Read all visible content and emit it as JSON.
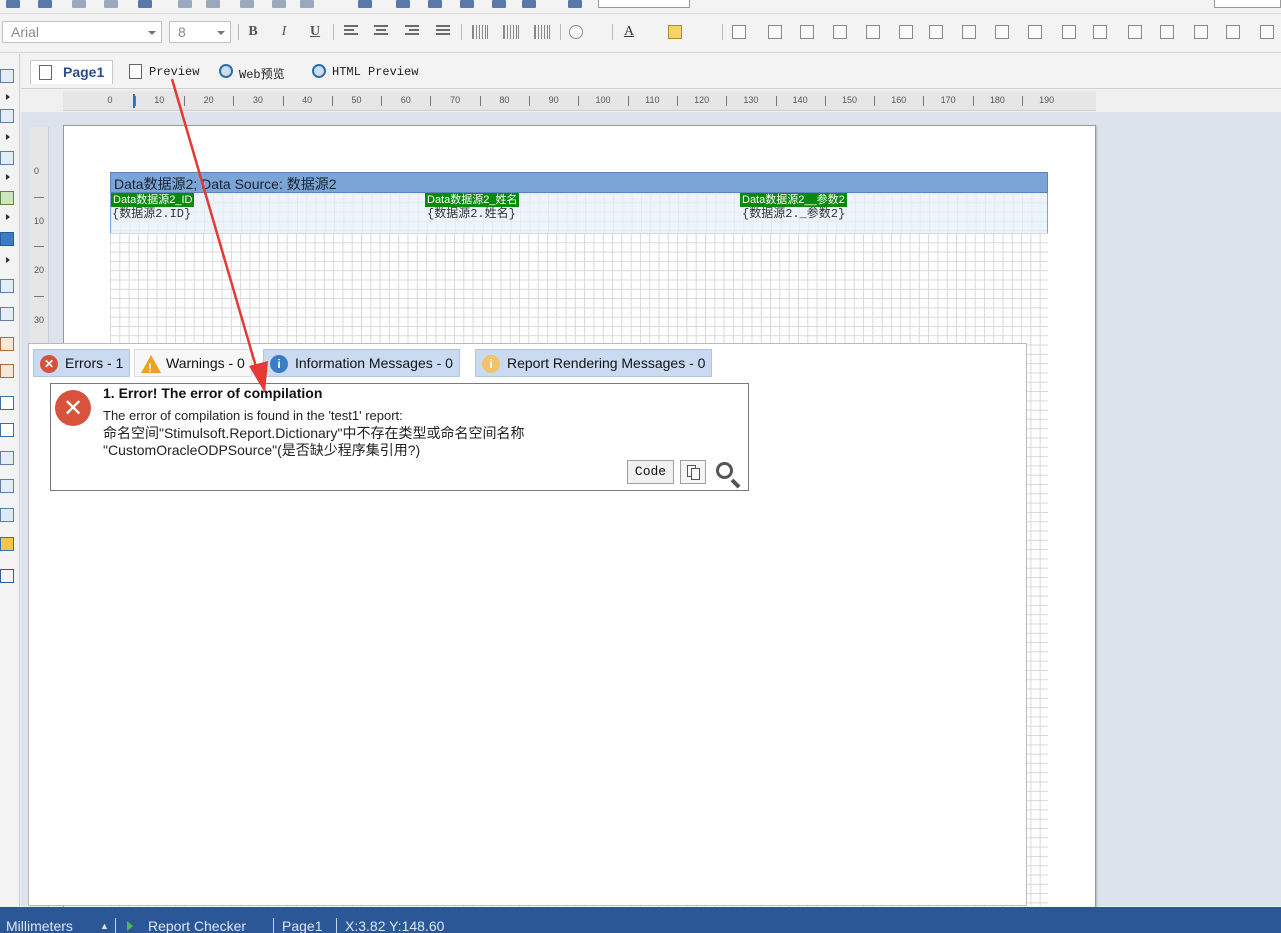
{
  "toolbar": {
    "font_name": "Arial",
    "font_size": "8",
    "bold": "B",
    "italic": "I",
    "underline": "U",
    "font_color_label": "A"
  },
  "page_tabs": [
    {
      "label": "Page1"
    },
    {
      "label": "Preview"
    },
    {
      "label": "Web预览"
    },
    {
      "label": "HTML Preview"
    }
  ],
  "ruler": {
    "labels": [
      "0",
      "10",
      "20",
      "30",
      "40",
      "50",
      "60",
      "70",
      "80",
      "90",
      "100",
      "110",
      "120",
      "130",
      "140",
      "150",
      "160",
      "170",
      "180",
      "190"
    ]
  },
  "vruler": {
    "labels": [
      "0",
      "10",
      "20",
      "30"
    ]
  },
  "band": {
    "header": "Data数据源2; Data  Source: 数据源2",
    "fields": [
      {
        "label": "Data数据源2_ID",
        "expr": "{数据源2.ID}"
      },
      {
        "label": "Data数据源2_姓名",
        "expr": "{数据源2.姓名}"
      },
      {
        "label": "Data数据源2__参数2",
        "expr": "{数据源2._参数2}"
      }
    ]
  },
  "error_tabs": [
    {
      "label": "Errors - 1",
      "icon": "error-icon"
    },
    {
      "label": "Warnings - 0",
      "icon": "warning-icon"
    },
    {
      "label": "Information Messages - 0",
      "icon": "info-icon"
    },
    {
      "label": "Report Rendering Messages - 0",
      "icon": "render-info-icon"
    }
  ],
  "error": {
    "title": "1. Error! The error of compilation",
    "line1": "The error of compilation is found in the 'test1' report:",
    "line2": "命名空间\"Stimulsoft.Report.Dictionary\"中不存在类型或命名空间名称",
    "line3": "\"CustomOracleODPSource\"(是否缺少程序集引用?)",
    "code_button": "Code"
  },
  "status": {
    "units": "Millimeters",
    "checker": "Report Checker",
    "page": "Page1",
    "coords": "X:3.82  Y:148.60"
  },
  "colors": {
    "band_header": "#7aa5d6",
    "field_label": "#0a8a0a",
    "error_red": "#d9533c",
    "statusbar": "#2b5797",
    "annotation_arrow": "#e53935"
  }
}
